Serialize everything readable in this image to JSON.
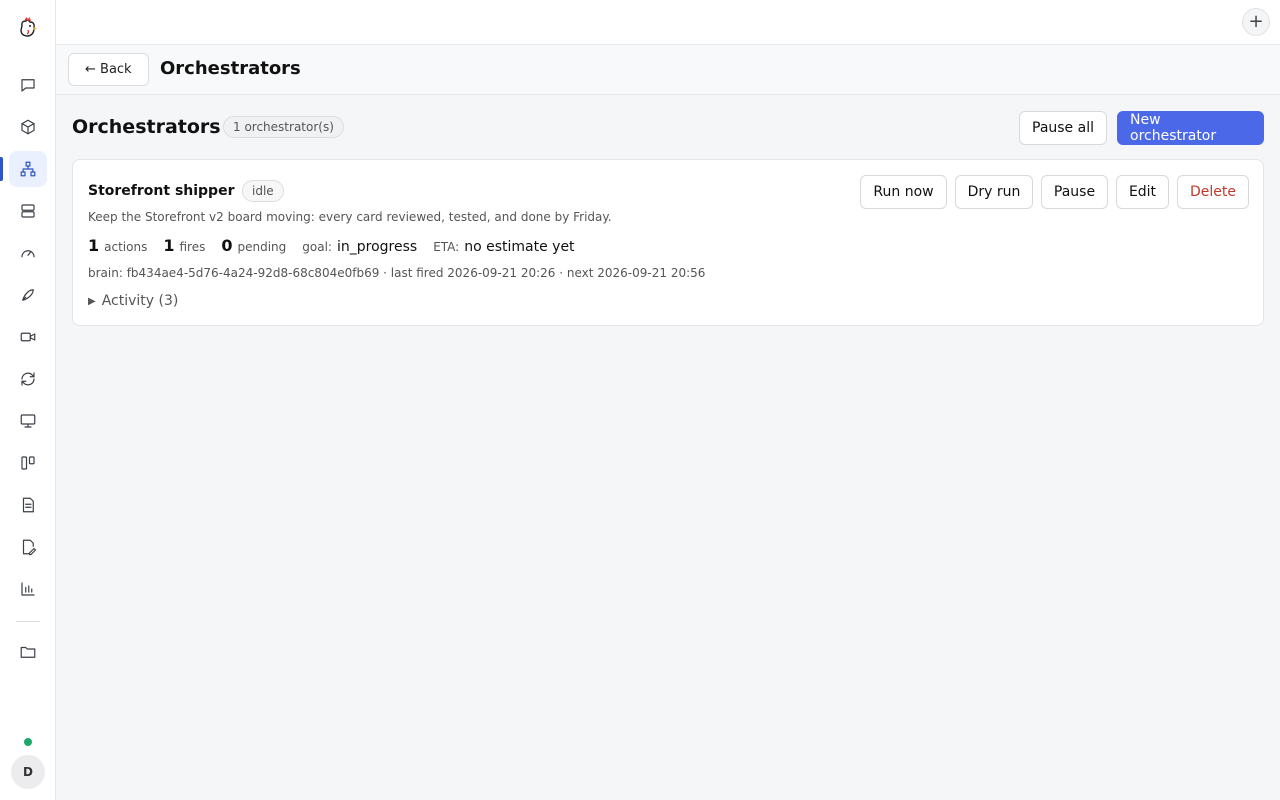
{
  "sidebar": {
    "logo_icon": "chicken-logo-icon",
    "items": [
      {
        "name": "chat",
        "icon": "chat-icon"
      },
      {
        "name": "packages",
        "icon": "cube-icon"
      },
      {
        "name": "orchestrators",
        "icon": "hierarchy-icon",
        "active": true
      },
      {
        "name": "servers",
        "icon": "server-icon"
      },
      {
        "name": "dashboard",
        "icon": "gauge-icon"
      },
      {
        "name": "deploy",
        "icon": "rocket-icon"
      },
      {
        "name": "recordings",
        "icon": "video-icon"
      },
      {
        "name": "sync",
        "icon": "refresh-icon"
      },
      {
        "name": "desktop",
        "icon": "monitor-icon"
      },
      {
        "name": "board",
        "icon": "kanban-icon"
      },
      {
        "name": "documents",
        "icon": "document-icon"
      },
      {
        "name": "edit-documents",
        "icon": "file-edit-icon"
      },
      {
        "name": "analytics",
        "icon": "bar-chart-icon"
      },
      {
        "name": "files",
        "icon": "folder-icon"
      }
    ],
    "status_color": "#1ea96b",
    "avatar_initial": "D"
  },
  "topbar": {
    "plus_label": "+"
  },
  "header": {
    "back_label": "← Back",
    "title": "Orchestrators"
  },
  "main": {
    "title": "Orchestrators",
    "count_badge": "1 orchestrator(s)",
    "pause_all_label": "Pause all",
    "new_label": "New orchestrator",
    "accent_color": "#4a68e8"
  },
  "orchestrator": {
    "name": "Storefront shipper",
    "state": "idle",
    "description": "Keep the Storefront v2 board moving: every card reviewed, tested, and done by Friday.",
    "actions_count": "1",
    "actions_label": "actions",
    "fires_count": "1",
    "fires_label": "fires",
    "pending_count": "0",
    "pending_label": "pending",
    "goal_key": "goal:",
    "goal_value": "in_progress",
    "eta_key": "ETA:",
    "eta_value": "no estimate yet",
    "meta": "brain: fb434ae4-5d76-4a24-92d8-68c804e0fb69 · last fired 2026-09-21 20:26 · next 2026-09-21 20:56",
    "activity_label": "Activity (3)",
    "buttons": {
      "run_now": "Run now",
      "dry_run": "Dry run",
      "pause": "Pause",
      "edit": "Edit",
      "delete": "Delete"
    }
  }
}
